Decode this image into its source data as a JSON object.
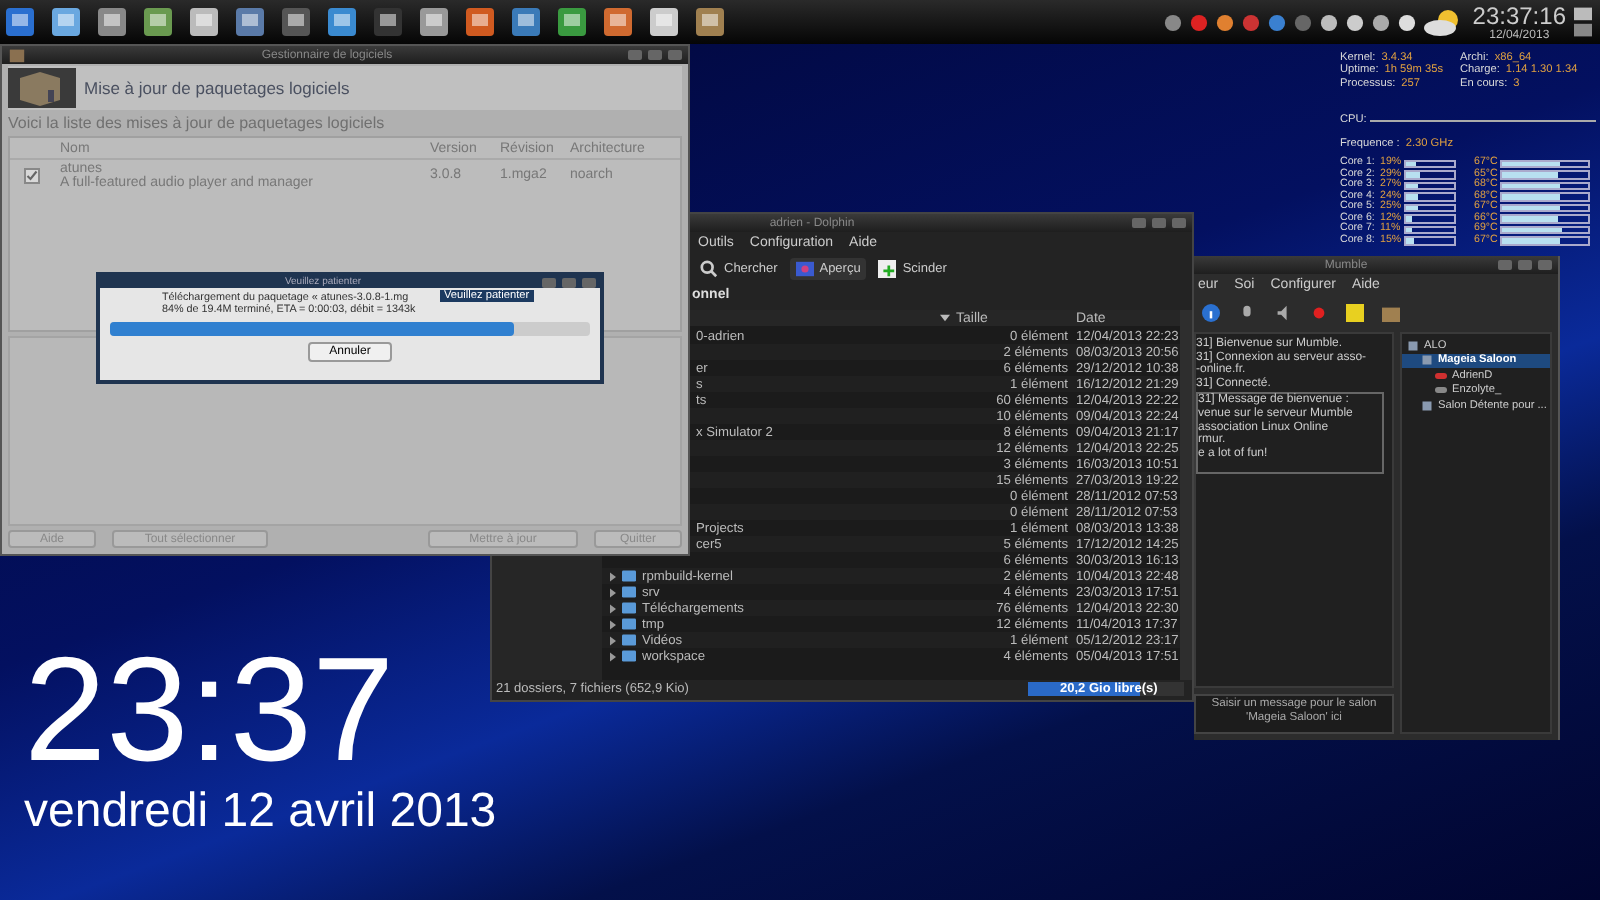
{
  "taskbar": {
    "clock": "23:37:16",
    "date": "12/04/2013"
  },
  "system_info": {
    "left": [
      {
        "label": "Kernel:",
        "value": "3.4.34"
      },
      {
        "label": "Uptime:",
        "value": "1h 59m 35s"
      },
      {
        "label": "Processus:",
        "value": "257"
      }
    ],
    "right": [
      {
        "label": "Archi:",
        "value": "x86_64"
      },
      {
        "label": "Charge:",
        "value": "1.14 1.30 1.34"
      },
      {
        "label": "En cours:",
        "value": "3"
      }
    ],
    "cpu_label": "CPU:",
    "frequency_label": "Frequence :",
    "frequency": "2.30 GHz",
    "cores": [
      {
        "label": "Core 1:",
        "usage": "19%",
        "usage_meter": {
          "level": 0.19
        },
        "temp": "67°C",
        "temp_meter": {
          "level": 0.67
        }
      },
      {
        "label": "Core 2:",
        "usage": "29%",
        "usage_meter": {
          "level": 0.29
        },
        "temp": "65°C",
        "temp_meter": {
          "level": 0.65
        }
      },
      {
        "label": "Core 3:",
        "usage": "27%",
        "usage_meter": {
          "level": 0.27
        },
        "temp": "68°C",
        "temp_meter": {
          "level": 0.68
        }
      },
      {
        "label": "Core 4:",
        "usage": "24%",
        "usage_meter": {
          "level": 0.24
        },
        "temp": "68°C",
        "temp_meter": {
          "level": 0.68
        }
      },
      {
        "label": "Core 5:",
        "usage": "25%",
        "usage_meter": {
          "level": 0.25
        },
        "temp": "67°C",
        "temp_meter": {
          "level": 0.67
        }
      },
      {
        "label": "Core 6:",
        "usage": "12%",
        "usage_meter": {
          "level": 0.12
        },
        "temp": "66°C",
        "temp_meter": {
          "level": 0.66
        }
      },
      {
        "label": "Core 7:",
        "usage": "11%",
        "usage_meter": {
          "level": 0.11
        },
        "temp": "69°C",
        "temp_meter": {
          "level": 0.69
        }
      },
      {
        "label": "Core 8:",
        "usage": "15%",
        "usage_meter": {
          "level": 0.15
        },
        "temp": "67°C",
        "temp_meter": {
          "level": 0.67
        }
      }
    ]
  },
  "software_window": {
    "title": "Gestionnaire de logiciels",
    "header": "Mise à jour de paquetages logiciels",
    "subtitle": "Voici la liste des mises à jour de paquetages logiciels",
    "columns": [
      "Nom",
      "Version",
      "Révision",
      "Architecture"
    ],
    "rows": [
      {
        "checked": true,
        "name": "atunes",
        "description": "A full-featured audio player and manager",
        "version": "3.0.8",
        "revision": "1.mga2",
        "arch": "noarch"
      }
    ],
    "buttons": [
      "Aide",
      "Tout sélectionner",
      "Mettre à jour",
      "Quitter"
    ]
  },
  "dialog": {
    "title": "Veuillez patienter",
    "line1": "Téléchargement du paquetage « atunes-3.0.8-1.mg",
    "line2": "84% de 19.4M terminé, ETA = 0:00:03, débit = 1343k",
    "tooltip": "Veuillez patienter",
    "progress": {
      "level": 0.84
    },
    "button": "Annuler"
  },
  "file_manager": {
    "title": "adrien - Dolphin",
    "menus": [
      "Outils",
      "Configuration",
      "Aide"
    ],
    "toolbar": [
      "Chercher",
      "Aperçu",
      "Scinder"
    ],
    "breadcrumb": "onnel",
    "columns": [
      "Taille",
      "Date"
    ],
    "rows": [
      {
        "kind": "clipped",
        "name": "0-adrien",
        "size": "0 élément",
        "date": "12/04/2013 22:23"
      },
      {
        "kind": "clipped",
        "size": "2 éléments",
        "date": "08/03/2013 20:56"
      },
      {
        "kind": "clipped",
        "name": "er",
        "size": "6 éléments",
        "date": "29/12/2012 10:38"
      },
      {
        "kind": "clipped",
        "name": "s",
        "size": "1 élément",
        "date": "16/12/2012 21:29"
      },
      {
        "kind": "clipped",
        "name": "ts",
        "size": "60 éléments",
        "date": "12/04/2013 22:22"
      },
      {
        "kind": "clipped",
        "size": "10 éléments",
        "date": "09/04/2013 22:24"
      },
      {
        "kind": "clipped",
        "name": "x Simulator 2",
        "size": "8 éléments",
        "date": "09/04/2013 21:17"
      },
      {
        "kind": "clipped",
        "size": "12 éléments",
        "date": "12/04/2013 22:25"
      },
      {
        "kind": "clipped",
        "size": "3 éléments",
        "date": "16/03/2013 10:51"
      },
      {
        "kind": "clipped",
        "size": "15 éléments",
        "date": "27/03/2013 19:22"
      },
      {
        "kind": "clipped",
        "size": "0 élément",
        "date": "28/11/2012 07:53"
      },
      {
        "kind": "clipped",
        "size": "0 élément",
        "date": "28/11/2012 07:53"
      },
      {
        "kind": "clipped",
        "name": "Projects",
        "size": "1 élément",
        "date": "08/03/2013 13:38"
      },
      {
        "kind": "clipped",
        "name": "cer5",
        "size": "5 éléments",
        "date": "17/12/2012 14:25"
      },
      {
        "kind": "clipped",
        "size": "6 éléments",
        "date": "30/03/2013 16:13"
      },
      {
        "kind": "folder",
        "name": "rpmbuild-kernel",
        "size": "2 éléments",
        "date": "10/04/2013 22:48"
      },
      {
        "kind": "folder",
        "name": "srv",
        "size": "4 éléments",
        "date": "23/03/2013 17:51"
      },
      {
        "kind": "folder",
        "name": "Téléchargements",
        "size": "76 éléments",
        "date": "12/04/2013 22:30"
      },
      {
        "kind": "folder",
        "name": "tmp",
        "size": "12 éléments",
        "date": "11/04/2013 17:37"
      },
      {
        "kind": "folder",
        "name": "Vidéos",
        "size": "1 élément",
        "date": "05/12/2012 23:17"
      },
      {
        "kind": "folder",
        "name": "workspace",
        "size": "4 éléments",
        "date": "05/04/2013 17:51"
      }
    ],
    "status": "21 dossiers, 7 fichiers (652,9 Kio)",
    "free_space": {
      "label": "20,2 Gio libre(s)",
      "level": 0.72
    }
  },
  "voice_chat": {
    "title": "Mumble",
    "menus": [
      "eur",
      "Soi",
      "Configurer",
      "Aide"
    ],
    "log": [
      "31] Bienvenue sur Mumble.",
      "31] Connexion au serveur asso-",
      "-online.fr.",
      "31] Connecté."
    ],
    "welcome": [
      "31] Message de bienvenue :",
      "venue sur le serveur Mumble",
      "association Linux Online",
      "rmur.",
      "e a lot of fun!"
    ],
    "tree": [
      {
        "name": "ALO",
        "kind": "server",
        "selected": false,
        "children": [
          {
            "name": "Mageia Saloon",
            "kind": "channel",
            "selected": true,
            "children": [
              {
                "name": "AdrienD",
                "kind": "user",
                "selected": false
              },
              {
                "name": "Enzolyte_",
                "kind": "user",
                "selected": false
              }
            ]
          },
          {
            "name": "Salon Détente pour ...",
            "kind": "channel",
            "selected": false
          }
        ]
      }
    ],
    "input": {
      "placeholder": "Saisir un message pour le salon 'Mageia Saloon' ici"
    }
  },
  "desktop_clock": {
    "time": "23:37",
    "date": "vendredi 12 avril 2013"
  }
}
